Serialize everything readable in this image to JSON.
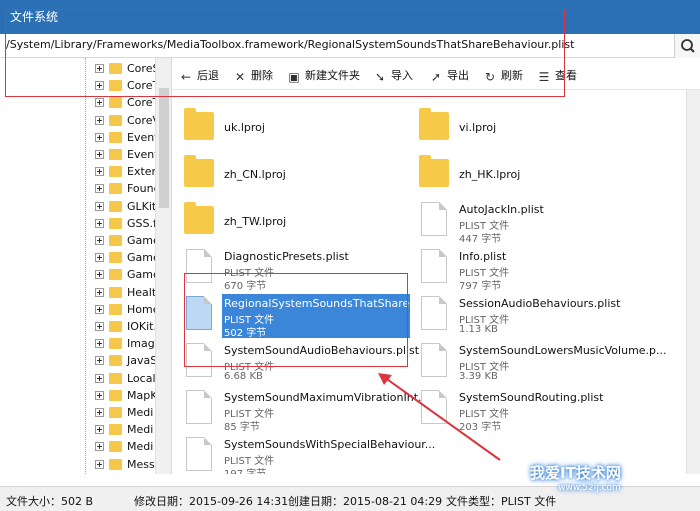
{
  "window": {
    "title": "文件系统"
  },
  "path_bar": {
    "path": "/System/Library/Frameworks/MediaToolbox.framework/RegionalSystemSoundsThatShareBehaviour.plist",
    "search_icon": "search-icon"
  },
  "tree": {
    "items": [
      "CoreS",
      "CoreT",
      "CoreT",
      "CoreV",
      "Event",
      "Event",
      "Exter",
      "Found",
      "GLKit",
      "GSS.fr",
      "Game",
      "Game",
      "Game",
      "Healt",
      "Home",
      "IOKit.",
      "Imag",
      "JavaS",
      "Local",
      "MapK",
      "Medi",
      "Medi",
      "Medi",
      "Mess"
    ]
  },
  "toolbar": {
    "back": "后退",
    "delete": "删除",
    "new_folder": "新建文件夹",
    "import": "导入",
    "export": "导出",
    "refresh": "刷新",
    "view": "查看"
  },
  "files": [
    {
      "name": "uk.lproj",
      "kind": "folder"
    },
    {
      "name": "vi.lproj",
      "kind": "folder"
    },
    {
      "name": "zh_CN.lproj",
      "kind": "folder"
    },
    {
      "name": "zh_HK.lproj",
      "kind": "folder"
    },
    {
      "name": "zh_TW.lproj",
      "kind": "folder"
    },
    {
      "name": "AutoJackIn.plist",
      "type": "PLIST 文件",
      "size": "447 字节"
    },
    {
      "name": "DiagnosticPresets.plist",
      "type": "PLIST 文件",
      "size": "670 字节"
    },
    {
      "name": "Info.plist",
      "type": "PLIST 文件",
      "size": "797 字节"
    },
    {
      "name": "RegionalSystemSoundsThatShareBe...",
      "type": "PLIST 文件",
      "size": "502 字节"
    },
    {
      "name": "SessionAudioBehaviours.plist",
      "type": "PLIST 文件",
      "size": "1.13 KB"
    },
    {
      "name": "SystemSoundAudioBehaviours.plist",
      "type": "PLIST 文件",
      "size": "6.68 KB"
    },
    {
      "name": "SystemSoundLowersMusicVolume.p...",
      "type": "PLIST 文件",
      "size": "3.39 KB"
    },
    {
      "name": "SystemSoundMaximumVibrationInt...",
      "type": "PLIST 文件",
      "size": "85 字节"
    },
    {
      "name": "SystemSoundRouting.plist",
      "type": "PLIST 文件",
      "size": "203 字节"
    },
    {
      "name": "SystemSoundsWithSpecialBehaviour...",
      "type": "PLIST 文件",
      "size": "197 字节"
    }
  ],
  "status": {
    "size": "文件大小：502 B",
    "modified": "修改日期：2015-09-26 14:31",
    "created": "创建日期：2015-08-21 04:29",
    "type": "文件类型：PLIST 文件"
  },
  "watermark": {
    "main": "我爱IT技术网",
    "sub": "www.52ij.com"
  },
  "colors": {
    "titlebar": "#2b6fb5",
    "selection": "#3b86d8",
    "annotation": "#d9363e",
    "folder": "#f7c948"
  }
}
